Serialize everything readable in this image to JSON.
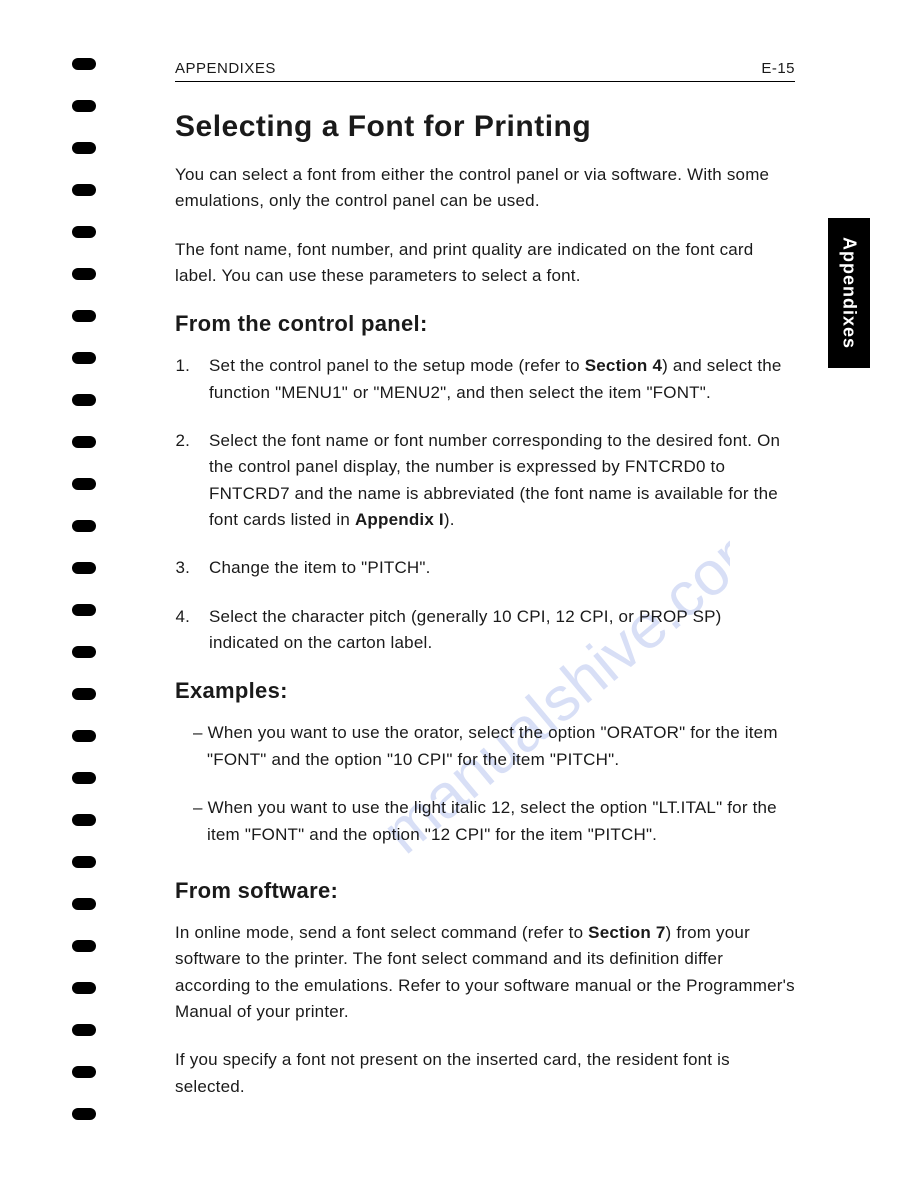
{
  "header": {
    "section": "APPENDIXES",
    "page_number": "E-15"
  },
  "side_tab": "Appendixes",
  "title": "Selecting a Font for Printing",
  "intro_p1": "You can select a font from either the control panel or via software. With some emulations, only the control panel can be used.",
  "intro_p2": "The font name, font number, and print quality are indicated on the font card label. You can use these parameters to select a font.",
  "control_panel": {
    "heading": "From the control panel:",
    "steps": [
      {
        "pre": "Set the control panel to the setup mode (refer to ",
        "bold": "Section 4",
        "post": ") and select the function \"MENU1\" or \"MENU2\", and then select the item \"FONT\"."
      },
      {
        "pre": "Select the font name or font number corresponding to the desired font. On the control panel display, the number is expressed by FNTCRD0 to FNTCRD7 and the name is abbreviated (the font name is available for the font cards listed in ",
        "bold": "Appendix I",
        "post": ")."
      },
      {
        "pre": "Change the item to \"PITCH\".",
        "bold": "",
        "post": ""
      },
      {
        "pre": "Select the character pitch (generally 10 CPI, 12 CPI, or PROP SP) indicated on the carton label.",
        "bold": "",
        "post": ""
      }
    ]
  },
  "examples": {
    "heading": "Examples:",
    "items": [
      "When you want to use the orator, select the option \"ORATOR\" for the item \"FONT\" and the option \"10 CPI\" for the item \"PITCH\".",
      "When you want to use the light italic 12, select the option \"LT.ITAL\" for the item \"FONT\" and the option \"12 CPI\" for the item \"PITCH\"."
    ]
  },
  "software": {
    "heading": "From software:",
    "p1_pre": "In online mode, send a font select command (refer to ",
    "p1_bold": "Section 7",
    "p1_post": ") from your software to the printer. The font select command and its definition differ according to the emulations. Refer to your software manual or the Programmer's Manual of your printer.",
    "p2": "If you specify a font not present on the inserted card, the resident font is selected."
  },
  "watermark": "manualshive.com"
}
